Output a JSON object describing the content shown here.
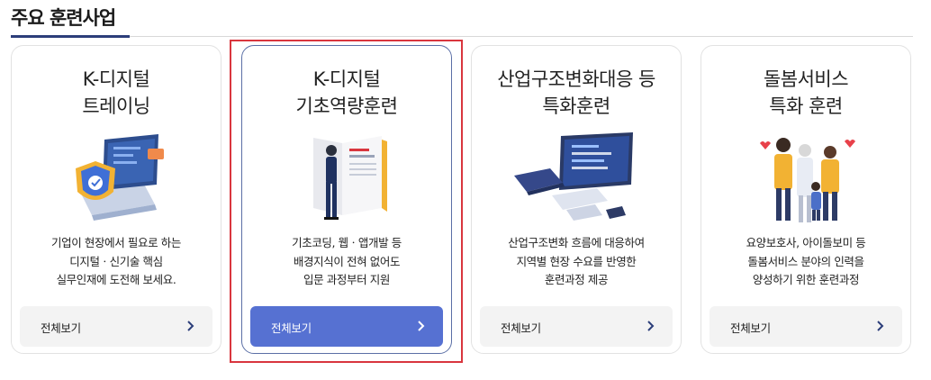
{
  "section": {
    "title": "주요 훈련사업"
  },
  "colors": {
    "accent": "#5671d2",
    "highlight": "#d9363e",
    "underline": "#2c3e7a"
  },
  "cards": [
    {
      "title_line1": "K-디지털",
      "title_line2": "트레이닝",
      "desc_line1": "기업이 현장에서 필요로 하는",
      "desc_line2": "디지털ㆍ신기술 핵심",
      "desc_line3": "실무인재에 도전해 보세요.",
      "button_label": "전체보기",
      "icon": "laptop-security-shield-icon"
    },
    {
      "title_line1": "K-디지털",
      "title_line2": "기초역량훈련",
      "desc_line1": "기초코딩, 웹ㆍ앱개발 등",
      "desc_line2": "배경지식이 전혀 없어도",
      "desc_line3": "입문 과정부터 지원",
      "button_label": "전체보기",
      "icon": "person-manual-book-icon"
    },
    {
      "title_line1": "산업구조변화대응 등",
      "title_line2": "특화훈련",
      "desc_line1": "산업구조변화 흐름에 대응하여",
      "desc_line2": "지역별 현장 수요를 반영한",
      "desc_line3": "훈련과정 제공",
      "button_label": "전체보기",
      "icon": "devices-monitor-icon"
    },
    {
      "title_line1": "돌봄서비스",
      "title_line2": "특화 훈련",
      "desc_line1": "요양보호사, 아이돌보미 등",
      "desc_line2": "돌봄서비스 분야의 인력을",
      "desc_line3": "양성하기 위한 훈련과정",
      "button_label": "전체보기",
      "icon": "care-family-icon"
    }
  ]
}
